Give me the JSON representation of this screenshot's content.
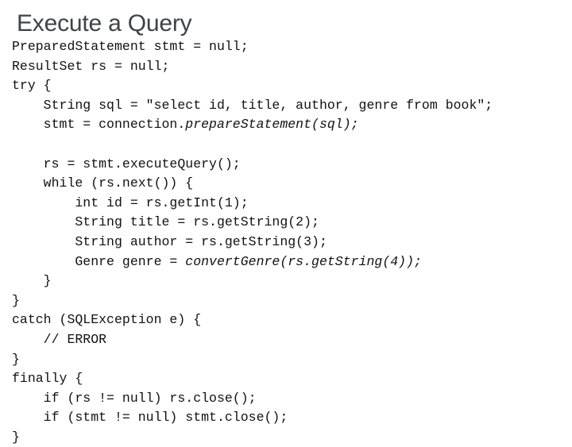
{
  "slide": {
    "title": "Execute a Query",
    "title_color": "#3f4248",
    "background_color": "#ffffff",
    "code_color": "#111111",
    "code": {
      "language": "java",
      "lines": [
        {
          "indent": 0,
          "segments": [
            {
              "text": "PreparedStatement stmt = null;",
              "italic": false
            }
          ]
        },
        {
          "indent": 0,
          "segments": [
            {
              "text": "ResultSet rs = null;",
              "italic": false
            }
          ]
        },
        {
          "indent": 0,
          "segments": [
            {
              "text": "try {",
              "italic": false
            }
          ]
        },
        {
          "indent": 4,
          "segments": [
            {
              "text": "String sql = \"select id, title, author, genre from book\";",
              "italic": false
            }
          ]
        },
        {
          "indent": 4,
          "segments": [
            {
              "text": "stmt = connection.",
              "italic": false
            },
            {
              "text": "prepareStatement(sql);",
              "italic": true
            }
          ]
        },
        {
          "indent": 0,
          "segments": [
            {
              "text": "",
              "italic": false
            }
          ]
        },
        {
          "indent": 4,
          "segments": [
            {
              "text": "rs = stmt.executeQuery();",
              "italic": false
            }
          ]
        },
        {
          "indent": 4,
          "segments": [
            {
              "text": "while (rs.next()) {",
              "italic": false
            }
          ]
        },
        {
          "indent": 8,
          "segments": [
            {
              "text": "int id = rs.getInt(1);",
              "italic": false
            }
          ]
        },
        {
          "indent": 8,
          "segments": [
            {
              "text": "String title = rs.getString(2);",
              "italic": false
            }
          ]
        },
        {
          "indent": 8,
          "segments": [
            {
              "text": "String author = rs.getString(3);",
              "italic": false
            }
          ]
        },
        {
          "indent": 8,
          "segments": [
            {
              "text": "Genre genre = ",
              "italic": false
            },
            {
              "text": "convertGenre(rs.getString(4));",
              "italic": true
            }
          ]
        },
        {
          "indent": 4,
          "segments": [
            {
              "text": "}",
              "italic": false
            }
          ]
        },
        {
          "indent": 0,
          "segments": [
            {
              "text": "}",
              "italic": false
            }
          ]
        },
        {
          "indent": 0,
          "segments": [
            {
              "text": "catch (SQLException e) {",
              "italic": false
            }
          ]
        },
        {
          "indent": 4,
          "segments": [
            {
              "text": "// ERROR",
              "italic": false
            }
          ]
        },
        {
          "indent": 0,
          "segments": [
            {
              "text": "}",
              "italic": false
            }
          ]
        },
        {
          "indent": 0,
          "segments": [
            {
              "text": "finally {",
              "italic": false
            }
          ]
        },
        {
          "indent": 4,
          "segments": [
            {
              "text": "if (rs != null) rs.close();",
              "italic": false
            }
          ]
        },
        {
          "indent": 4,
          "segments": [
            {
              "text": "if (stmt != null) stmt.close();",
              "italic": false
            }
          ]
        },
        {
          "indent": 0,
          "segments": [
            {
              "text": "}",
              "italic": false
            }
          ]
        }
      ]
    }
  }
}
